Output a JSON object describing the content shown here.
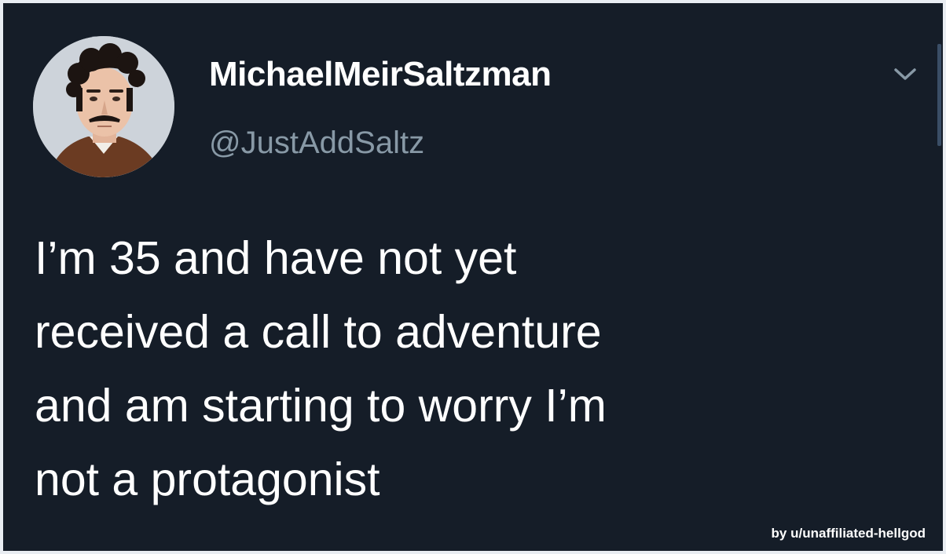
{
  "tweet": {
    "display_name": "MichaelMeirSaltzman",
    "handle": "@JustAddSaltz",
    "text_lines": [
      "I’m 35 and have not yet",
      "received a call to adventure",
      "and am starting to worry I’m",
      "not a protagonist"
    ],
    "menu_icon": "chevron-down-icon"
  },
  "watermark": {
    "text": "by u/unaffiliated-hellgod"
  },
  "colors": {
    "background": "#151d28",
    "name_text": "#ffffff",
    "handle_text": "#8899a6",
    "body_text": "#ffffff"
  }
}
